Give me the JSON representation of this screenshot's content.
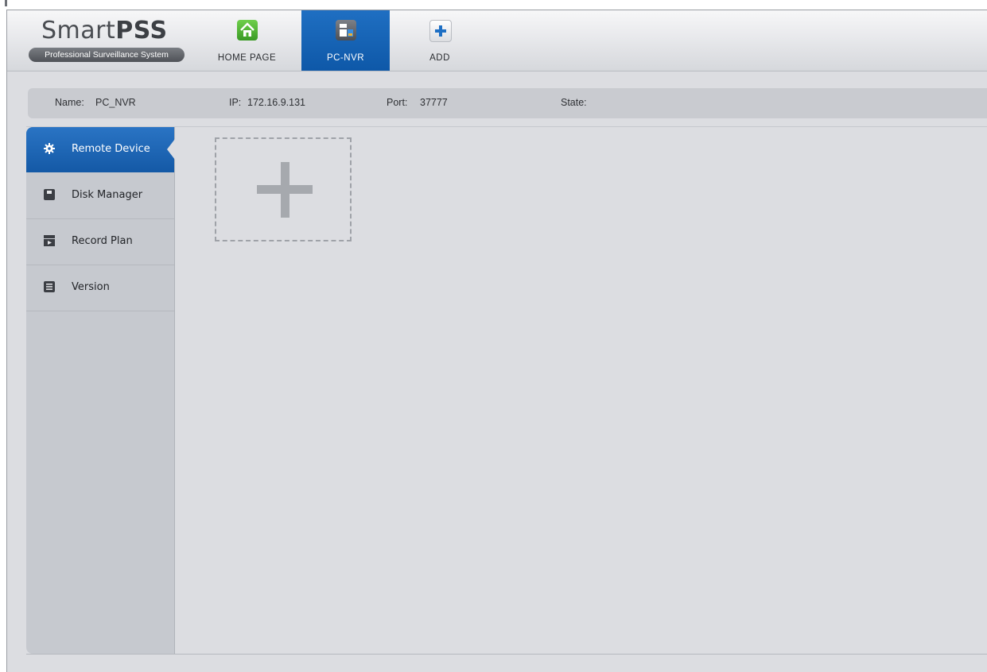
{
  "app": {
    "logo_text_light": "Smart",
    "logo_text_bold": "PSS",
    "logo_subtitle": "Professional Surveillance System"
  },
  "tabs": [
    {
      "label": "HOME PAGE",
      "icon": "home-icon",
      "active": false
    },
    {
      "label": "PC-NVR",
      "icon": "pc-nvr-icon",
      "active": true
    },
    {
      "label": "ADD",
      "icon": "plus-icon",
      "active": false
    }
  ],
  "info": {
    "name_label": "Name:",
    "name_value": "PC_NVR",
    "ip_label": "IP:",
    "ip_value": "172.16.9.131",
    "port_label": "Port:",
    "port_value": "37777",
    "state_label": "State:"
  },
  "sidebar": {
    "items": [
      {
        "label": "Remote Device",
        "icon": "gear-icon",
        "active": true
      },
      {
        "label": "Disk Manager",
        "icon": "disk-icon",
        "active": false
      },
      {
        "label": "Record Plan",
        "icon": "record-plan-icon",
        "active": false
      },
      {
        "label": "Version",
        "icon": "version-list-icon",
        "active": false
      }
    ]
  },
  "colors": {
    "accent": "#1a63b4",
    "background": "#dcdde1",
    "sidebar": "#c6c9cf"
  }
}
